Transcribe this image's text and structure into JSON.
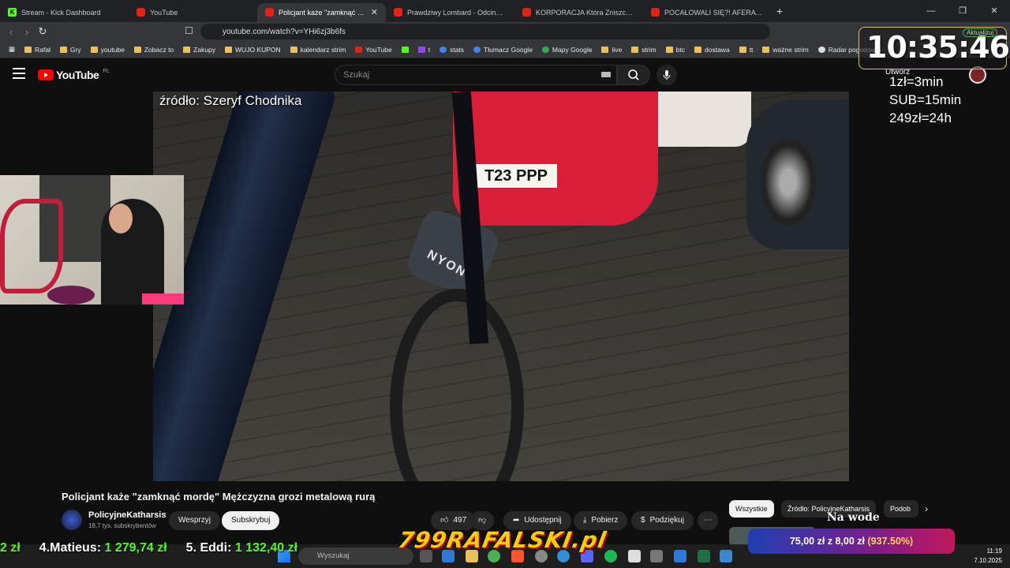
{
  "browser": {
    "tabs": [
      {
        "title": "Stream - Kick Dashboard",
        "favicon": "kick-icon",
        "active": false
      },
      {
        "title": "YouTube",
        "favicon": "youtube-icon",
        "active": false
      },
      {
        "title": "Policjant każe \"zamknąć mordę\"",
        "favicon": "youtube-icon",
        "active": true
      },
      {
        "title": "Prawdziwy Lombard - Odcinek 293 \"I",
        "favicon": "youtube-icon",
        "active": false
      },
      {
        "title": "KORPORACJA Która Zniszczyła Świat",
        "favicon": "youtube-icon",
        "active": false
      },
      {
        "title": "POCAŁOWALI SIĘ?! AFERA KOPERKO",
        "favicon": "youtube-icon",
        "active": false
      }
    ],
    "url": "youtube.com/watch?v=YHi6zj3b6fs",
    "update_label": "Aktualizuj",
    "bookmarks": [
      {
        "label": "Rafał",
        "icon": "folder"
      },
      {
        "label": "Gry",
        "icon": "folder"
      },
      {
        "label": "youtube",
        "icon": "folder"
      },
      {
        "label": "Zobacz to",
        "icon": "folder"
      },
      {
        "label": "Zakupy",
        "icon": "folder"
      },
      {
        "label": "WUJO KUPON",
        "icon": "folder"
      },
      {
        "label": "kalendarz strim",
        "icon": "folder"
      },
      {
        "label": "YouTube",
        "icon": "yt"
      },
      {
        "label": "",
        "icon": "dot"
      },
      {
        "label": "t",
        "icon": "tw"
      },
      {
        "label": "stats",
        "icon": "g"
      },
      {
        "label": "Tłumacz Google",
        "icon": "g"
      },
      {
        "label": "Mapy Google",
        "icon": "map"
      },
      {
        "label": "live",
        "icon": "folder"
      },
      {
        "label": "strim",
        "icon": "folder"
      },
      {
        "label": "btc",
        "icon": "folder"
      },
      {
        "label": "dostawa",
        "icon": "folder"
      },
      {
        "label": "tt",
        "icon": "folder"
      },
      {
        "label": "ważne strim",
        "icon": "folder"
      },
      {
        "label": "Radar pogodowy -",
        "icon": "radar"
      }
    ]
  },
  "youtube": {
    "logo_text": "YouTube",
    "logo_region": "PL",
    "search_placeholder": "Szukaj",
    "create_label": "Utwórz",
    "video_overlay_text": "źródło: Szeryf Chodnika",
    "plate_text": "T23 PPP",
    "mudguard_text": "NYON",
    "video_title": "Policjant każe \"zamknąć mordę\" Mężczyzna grozi metalową rurą",
    "channel_name": "PolicyjneKatharsis",
    "channel_subs": "18,7 tys. subskrybentów",
    "support_label": "Wesprzyj",
    "subscribe_label": "Subskrybuj",
    "like_count": "497",
    "share_label": "Udostępnij",
    "download_label": "Pobierz",
    "thanks_label": "Podziękuj",
    "chips": [
      "Wszystkie",
      "Źródło: PolicyjneKatharsis",
      "Podob"
    ]
  },
  "stream_overlay": {
    "timer": "10:35:46",
    "prices": [
      "1zł=3min",
      "SUB=15min",
      "249zł=24h"
    ],
    "leaderboard": [
      {
        "rank_name": "",
        "amount": "2 zł"
      },
      {
        "rank_name": "4.Matieus:",
        "amount": "1 279,74 zł"
      },
      {
        "rank_name": "5. Eddi:",
        "amount": "1 132,40 zł"
      }
    ],
    "brand": "799RAFALSKI.pl",
    "donation_main": "75,00 zł z 8,00 zł",
    "donation_pct": "(937.50%)",
    "sidebar_text": "Na wode"
  },
  "taskbar": {
    "search_placeholder": "Wyszukaj",
    "time": "11:19",
    "date": "7.10.2025"
  }
}
